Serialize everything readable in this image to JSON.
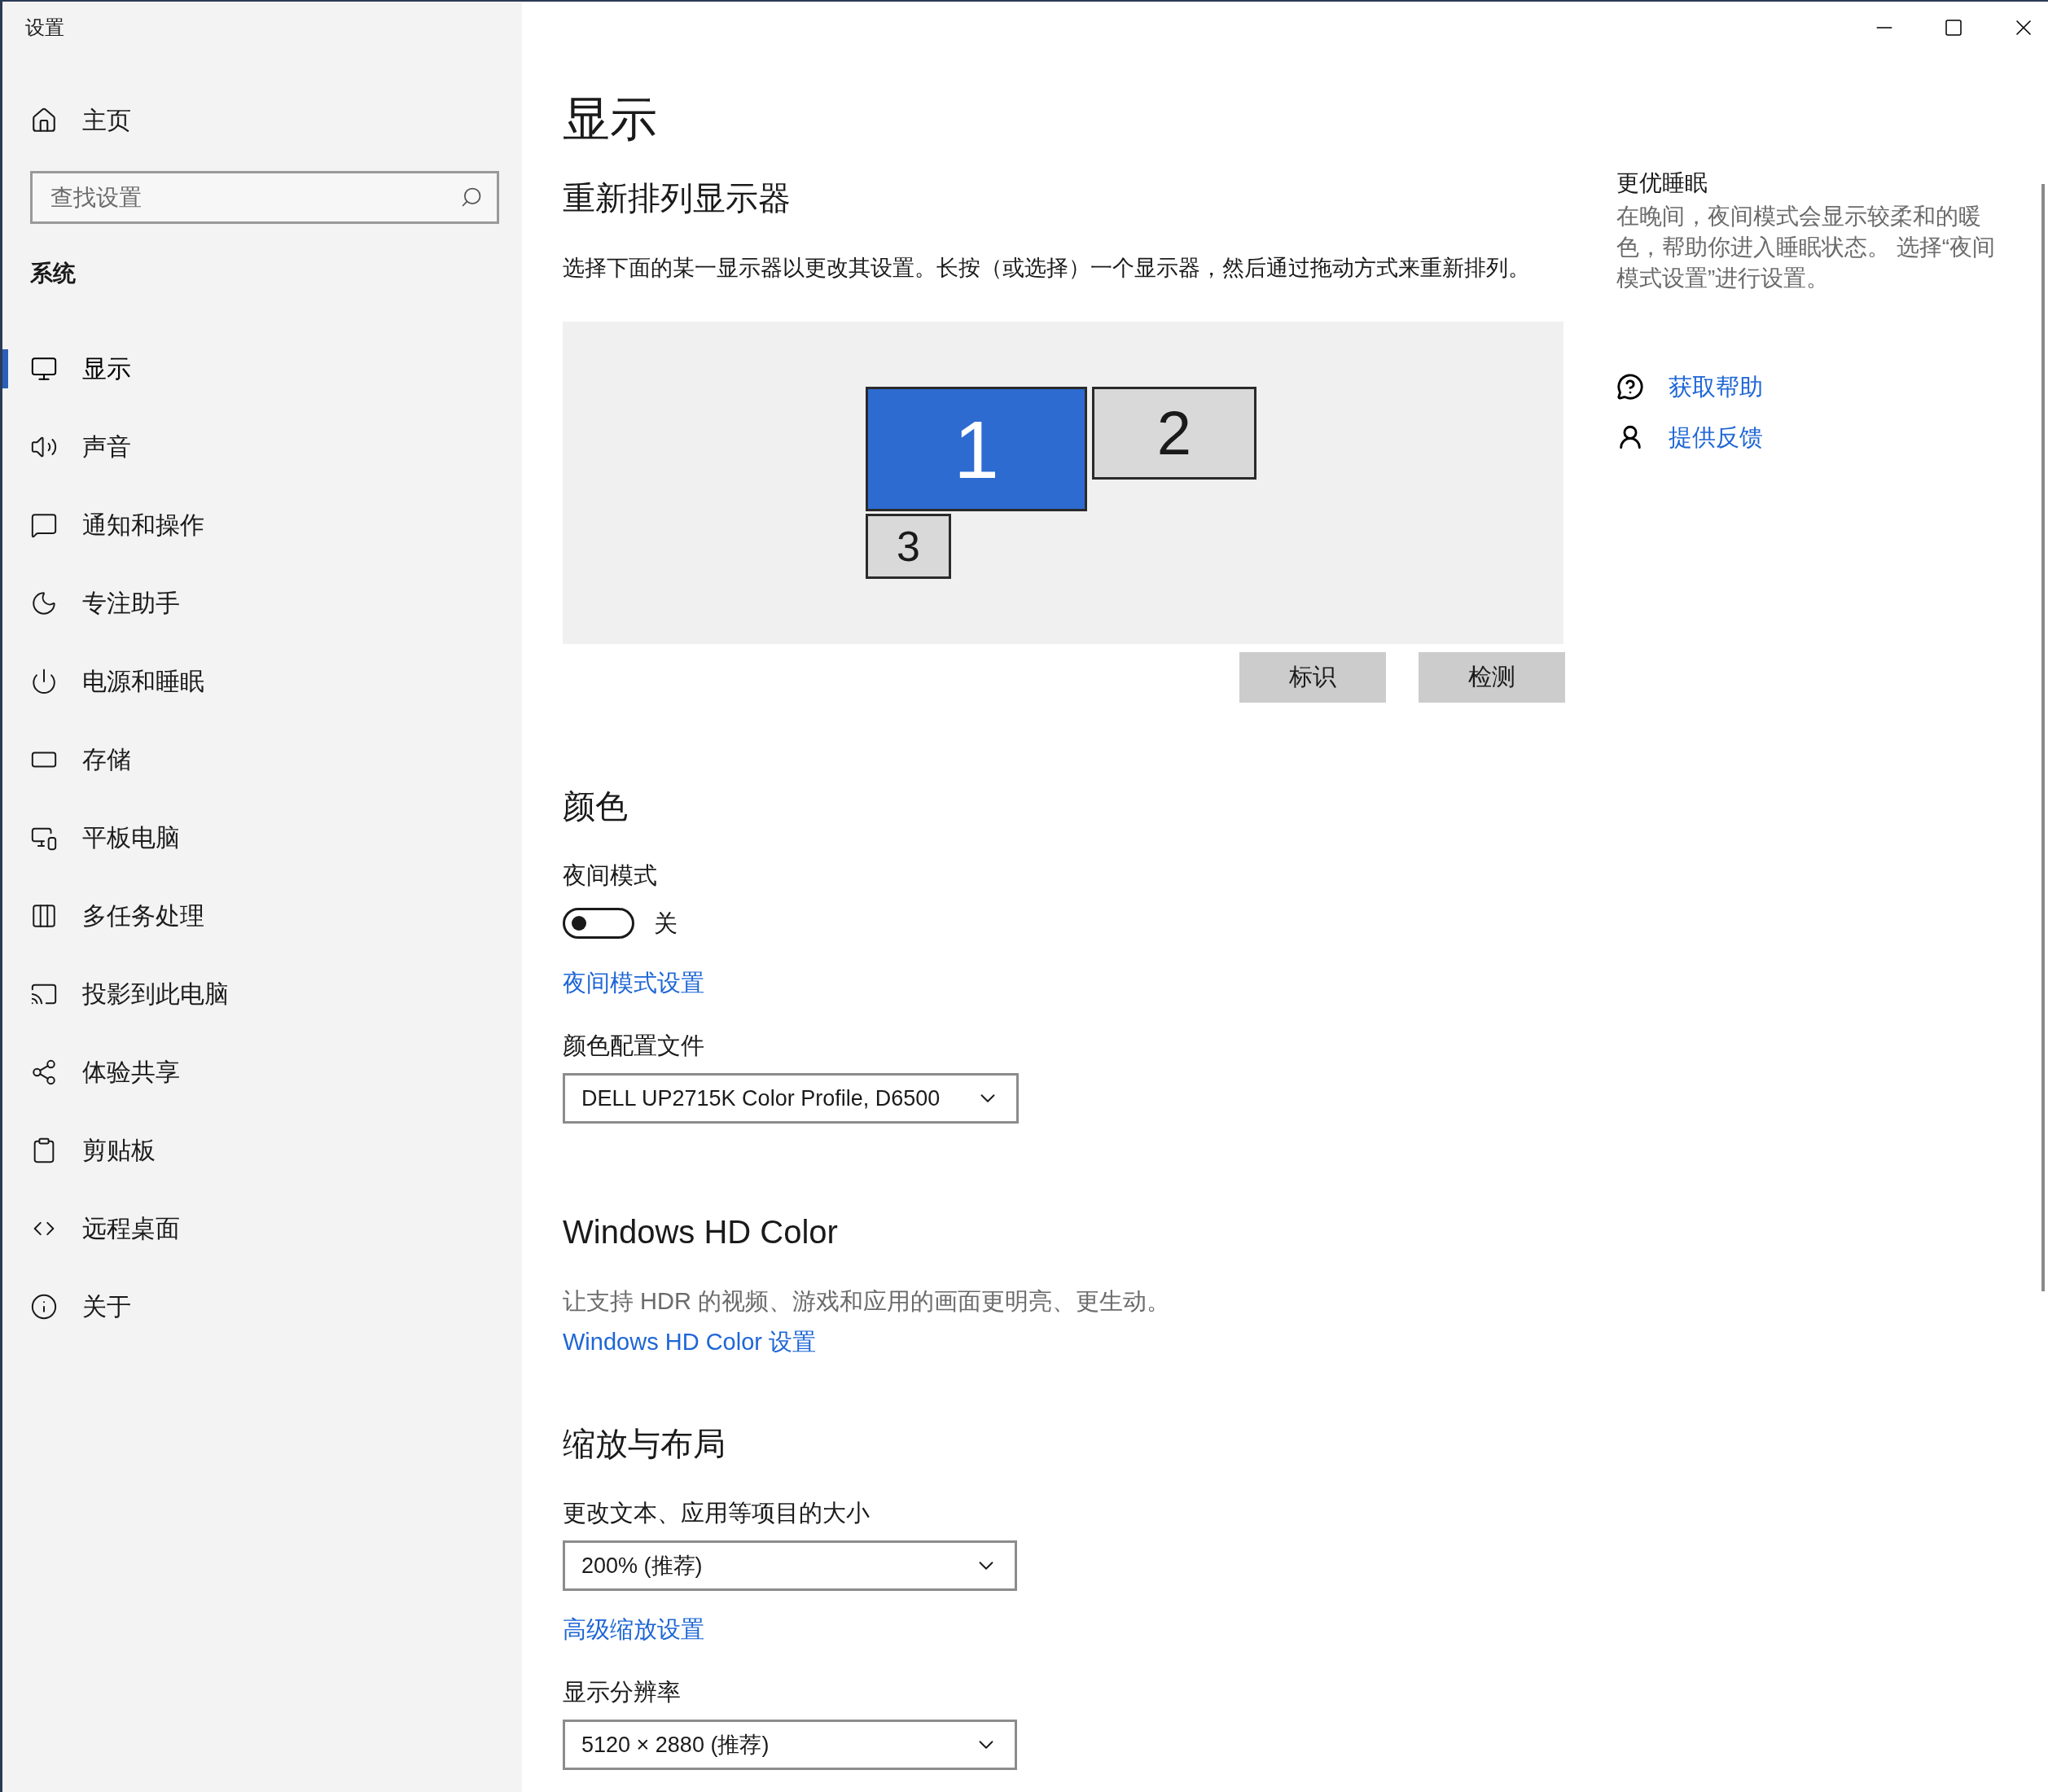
{
  "window": {
    "title": "设置"
  },
  "sidebar": {
    "home": "主页",
    "search": {
      "placeholder": "查找设置"
    },
    "section": "系统",
    "items": [
      {
        "label": "显示",
        "selected": true
      },
      {
        "label": "声音",
        "selected": false
      },
      {
        "label": "通知和操作",
        "selected": false
      },
      {
        "label": "专注助手",
        "selected": false
      },
      {
        "label": "电源和睡眠",
        "selected": false
      },
      {
        "label": "存储",
        "selected": false
      },
      {
        "label": "平板电脑",
        "selected": false
      },
      {
        "label": "多任务处理",
        "selected": false
      },
      {
        "label": "投影到此电脑",
        "selected": false
      },
      {
        "label": "体验共享",
        "selected": false
      },
      {
        "label": "剪贴板",
        "selected": false
      },
      {
        "label": "远程桌面",
        "selected": false
      },
      {
        "label": "关于",
        "selected": false
      }
    ]
  },
  "main": {
    "title": "显示",
    "rearrange": {
      "heading": "重新排列显示器",
      "description": "选择下面的某一显示器以更改其设置。长按（或选择）一个显示器，然后通过拖动方式来重新排列。",
      "monitors": [
        {
          "label": "1",
          "selected": true
        },
        {
          "label": "2",
          "selected": false
        },
        {
          "label": "3",
          "selected": false
        }
      ],
      "buttons": [
        "标识",
        "检测"
      ]
    },
    "color": {
      "heading": "颜色",
      "night_mode": {
        "label": "夜间模式",
        "on": false,
        "state_text": "关"
      },
      "link": "夜间模式设置",
      "profile": {
        "label": "颜色配置文件",
        "value": "DELL UP2715K Color Profile, D6500"
      }
    },
    "hdr": {
      "heading": "Windows HD Color",
      "description": "让支持 HDR 的视频、游戏和应用的画面更明亮、更生动。",
      "link": "Windows HD Color 设置"
    },
    "scale": {
      "heading": "缩放与布局",
      "size": {
        "label": "更改文本、应用等项目的大小",
        "value": "200% (推荐)"
      },
      "link": "高级缩放设置",
      "resolution": {
        "label": "显示分辨率",
        "value": "5120 × 2880 (推荐)"
      }
    }
  },
  "aside": {
    "heading": "更优睡眠",
    "text": "在晚间，夜间模式会显示较柔和的暖色，帮助你进入睡眠状态。 选择“夜间模式设置”进行设置。",
    "links": [
      {
        "label": "获取帮助",
        "kind": "help"
      },
      {
        "label": "提供反馈",
        "kind": "feedback"
      }
    ]
  }
}
